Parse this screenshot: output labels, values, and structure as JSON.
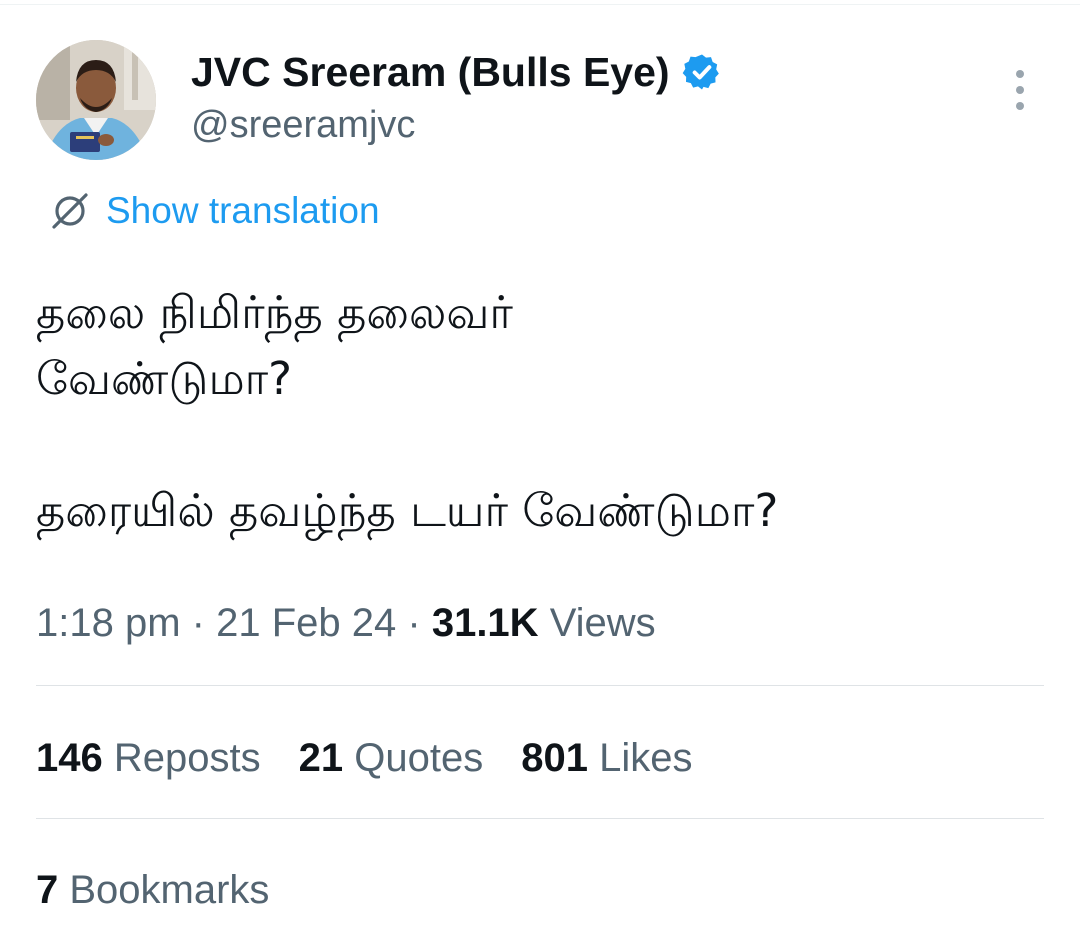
{
  "author": {
    "name": "JVC Sreeram (Bulls Eye)",
    "handle": "@sreeramjvc",
    "verified_icon": "verified-badge-icon",
    "verified_color": "#1d9bf0"
  },
  "translate": {
    "label": "Show translation",
    "icon": "globe-icon"
  },
  "tweet": {
    "lines": [
      "தலை நிமிர்ந்த தலைவர்",
      "வேண்டுமா?",
      "தரையில் தவழ்ந்த டயர் வேண்டுமா?"
    ]
  },
  "meta": {
    "time": "1:18 pm",
    "separator": "·",
    "date": "21 Feb 24",
    "views_count": "31.1K",
    "views_label": "Views"
  },
  "stats": {
    "reposts_count": "146",
    "reposts_label": "Reposts",
    "quotes_count": "21",
    "quotes_label": "Quotes",
    "likes_count": "801",
    "likes_label": "Likes",
    "bookmarks_count": "7",
    "bookmarks_label": "Bookmarks"
  },
  "colors": {
    "text": "#0f1419",
    "secondary": "#536471",
    "accent": "#1d9bf0",
    "divider": "#dfe3e6"
  }
}
